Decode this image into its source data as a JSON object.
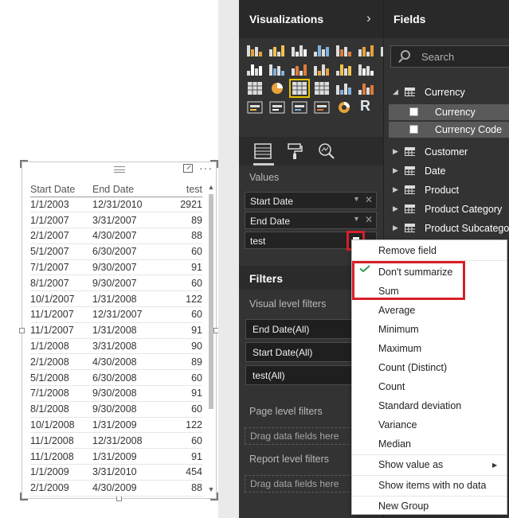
{
  "visualizations": {
    "title": "Visualizations",
    "icons": [
      "stacked-bar-chart-icon",
      "stacked-column-chart-icon",
      "clustered-bar-chart-icon",
      "clustered-column-chart-icon",
      "100-stacked-bar-chart-icon",
      "100-stacked-column-chart-icon",
      "line-chart-icon",
      "area-chart-icon",
      "stacked-area-chart-icon",
      "line-and-stacked-column-chart-icon",
      "line-and-clustered-column-chart-icon",
      "ribbon-chart-icon",
      "scatter-chart-icon",
      "pie-chart-icon",
      "treemap-icon",
      "map-icon",
      "table-icon",
      "matrix-icon",
      "waterfall-chart-icon",
      "funnel-icon",
      "gauge-icon",
      "card-icon",
      "multi-row-card-icon",
      "kpi-icon",
      "slicer-icon",
      "donut-chart-icon",
      "r-script-visual-icon",
      "more-visuals-icon"
    ],
    "r_label": "R",
    "more_label": "···",
    "values_label": "Values",
    "wells": [
      {
        "label": "Start Date"
      },
      {
        "label": "End Date"
      },
      {
        "label": "test"
      }
    ]
  },
  "filters": {
    "title": "Filters",
    "visual_level_label": "Visual level filters",
    "cards": [
      "End Date(All)",
      "Start Date(All)",
      "test(All)"
    ],
    "page_level_label": "Page level filters",
    "report_level_label": "Report level filters",
    "drop_placeholder": "Drag data fields here"
  },
  "fields": {
    "title": "Fields",
    "search_placeholder": "Search",
    "tables": [
      {
        "name": "Currency",
        "expanded": true,
        "fields": [
          "Currency",
          "Currency Code"
        ]
      },
      {
        "name": "Customer"
      },
      {
        "name": "Date"
      },
      {
        "name": "Product"
      },
      {
        "name": "Product Category"
      },
      {
        "name": "Product Subcategory"
      }
    ]
  },
  "table_visual": {
    "columns": [
      "Start Date",
      "End Date",
      "test"
    ],
    "rows": [
      [
        "1/1/2003",
        "12/31/2010",
        "2921"
      ],
      [
        "1/1/2007",
        "3/31/2007",
        "89"
      ],
      [
        "2/1/2007",
        "4/30/2007",
        "88"
      ],
      [
        "5/1/2007",
        "6/30/2007",
        "60"
      ],
      [
        "7/1/2007",
        "9/30/2007",
        "91"
      ],
      [
        "8/1/2007",
        "9/30/2007",
        "60"
      ],
      [
        "10/1/2007",
        "1/31/2008",
        "122"
      ],
      [
        "11/1/2007",
        "12/31/2007",
        "60"
      ],
      [
        "11/1/2007",
        "1/31/2008",
        "91"
      ],
      [
        "1/1/2008",
        "3/31/2008",
        "90"
      ],
      [
        "2/1/2008",
        "4/30/2008",
        "89"
      ],
      [
        "5/1/2008",
        "6/30/2008",
        "60"
      ],
      [
        "7/1/2008",
        "9/30/2008",
        "91"
      ],
      [
        "8/1/2008",
        "9/30/2008",
        "60"
      ],
      [
        "10/1/2008",
        "1/31/2009",
        "122"
      ],
      [
        "11/1/2008",
        "12/31/2008",
        "60"
      ],
      [
        "11/1/2008",
        "1/31/2009",
        "91"
      ],
      [
        "1/1/2009",
        "3/31/2010",
        "454"
      ],
      [
        "2/1/2009",
        "4/30/2009",
        "88"
      ]
    ]
  },
  "context_menu": {
    "items": [
      {
        "label": "Remove field"
      },
      {
        "label": "Don't summarize",
        "checked": true
      },
      {
        "label": "Sum"
      },
      {
        "label": "Average"
      },
      {
        "label": "Minimum"
      },
      {
        "label": "Maximum"
      },
      {
        "label": "Count (Distinct)"
      },
      {
        "label": "Count"
      },
      {
        "label": "Standard deviation"
      },
      {
        "label": "Variance"
      },
      {
        "label": "Median"
      },
      {
        "label": "Show value as",
        "submenu": true
      },
      {
        "label": "Show items with no data"
      },
      {
        "label": "New Group"
      }
    ]
  },
  "colors": {
    "pane_bg": "#333333",
    "highlight_red": "#d8202a",
    "check_green": "#2e9e4f",
    "selected_visual_outline": "#e6c200"
  }
}
